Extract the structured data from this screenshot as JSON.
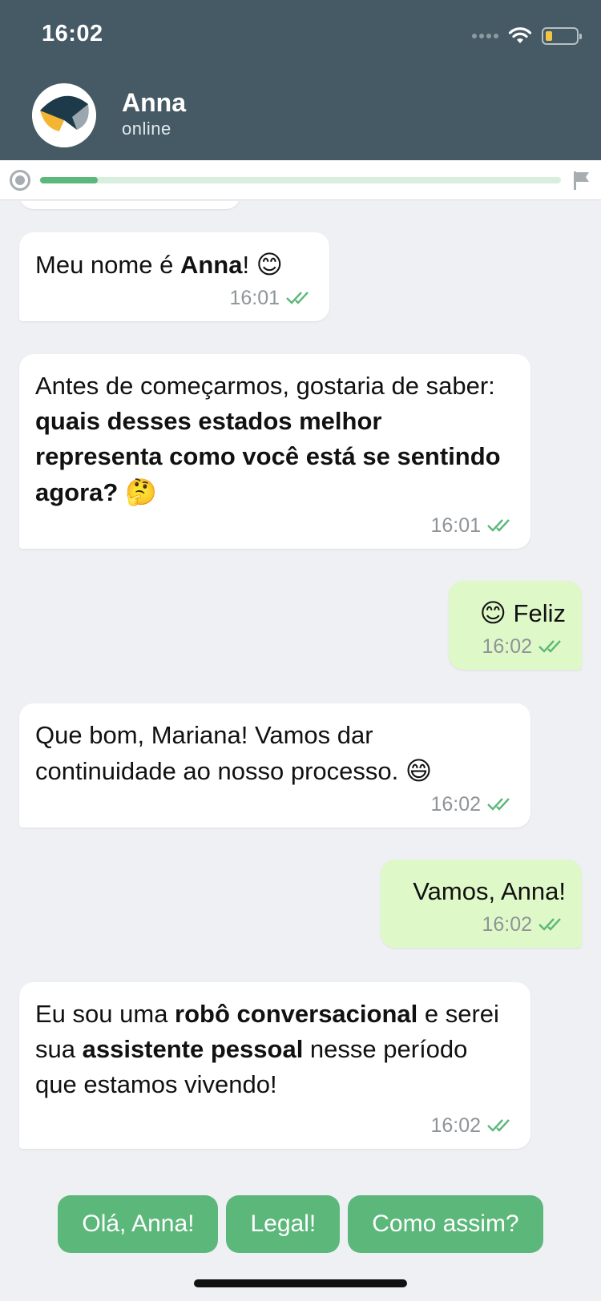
{
  "status_bar": {
    "time": "16:02"
  },
  "contact": {
    "name": "Anna",
    "status": "online"
  },
  "progress": {
    "fraction": 0.11
  },
  "messages": [
    {
      "from": "bot",
      "text_before": "Meu nome é ",
      "bold": "Anna",
      "text_after": "! ",
      "emoji": "😊",
      "time": "16:01"
    },
    {
      "from": "bot",
      "text_before": "Antes de começarmos, gostaria de saber: ",
      "bold": "quais desses estados melhor representa como você está se sentindo agora?",
      "text_after": " ",
      "emoji": "🤔",
      "time": "16:01"
    },
    {
      "from": "user",
      "emoji": "😊",
      "text": " Feliz",
      "time": "16:02"
    },
    {
      "from": "bot",
      "text": "Que bom, Mariana! Vamos dar continuidade ao nosso processo. ",
      "emoji": "😄",
      "time": "16:02"
    },
    {
      "from": "user",
      "text": "Vamos, Anna!",
      "time": "16:02"
    },
    {
      "from": "bot",
      "text_before": "Eu sou uma ",
      "bold": "robô conversacional",
      "text_mid": " e serei sua ",
      "bold2": "assistente pessoal",
      "text_after": " nesse período que estamos vivendo!",
      "time": "16:02"
    }
  ],
  "quick_replies": [
    "Olá, Anna!",
    "Legal!",
    "Como assim?"
  ],
  "colors": {
    "header": "#455a64",
    "accent": "#5cb87a",
    "user_bubble": "#dff8c8",
    "background": "#eff0f3"
  }
}
